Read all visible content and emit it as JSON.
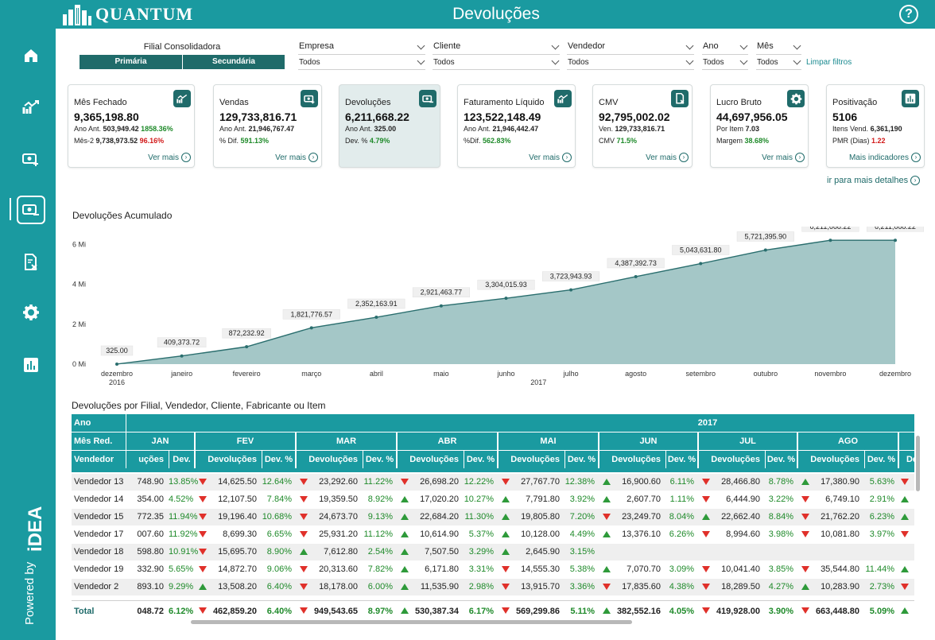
{
  "header": {
    "brand": "QUANTUM",
    "title": "Devoluções",
    "help_label": "?"
  },
  "sidebar": {
    "items": [
      {
        "name": "home-icon"
      },
      {
        "name": "trend-icon"
      },
      {
        "name": "money-plus-icon"
      },
      {
        "name": "money-minus-icon",
        "active": true
      },
      {
        "name": "document-x-icon"
      },
      {
        "name": "gear-icon"
      },
      {
        "name": "bar-chart-icon"
      }
    ],
    "powered_by": "Powered by",
    "powered_brand": "iDEA"
  },
  "filters": {
    "filial_label": "Filial Consolidadora",
    "filial_options": [
      "Primária",
      "Secundária"
    ],
    "empresa": {
      "label": "Empresa",
      "value": "Todos"
    },
    "cliente": {
      "label": "Cliente",
      "value": "Todos"
    },
    "vendedor": {
      "label": "Vendedor",
      "value": "Todos"
    },
    "ano": {
      "label": "Ano",
      "value": "Todos"
    },
    "mes": {
      "label": "Mês",
      "value": "Todos"
    },
    "clear_label": "Limpar filtros"
  },
  "cards": [
    {
      "title": "Mês Fechado",
      "value": "9,365,198.80",
      "l1_label": "Ano Ant.",
      "l1_value": "503,949.42",
      "l1_extra": "1858.36%",
      "l1_extra_color": "green",
      "l2_label": "Mês-2",
      "l2_value": "9,738,973.52",
      "l2_extra": "96.16%",
      "l2_extra_color": "red",
      "link": "Ver mais",
      "icon": "trend-icon"
    },
    {
      "title": "Vendas",
      "value": "129,733,816.71",
      "l1_label": "Ano Ant.",
      "l1_value": "21,946,767.47",
      "l1_extra": "",
      "l2_label": "% Dif.",
      "l2_value": "",
      "l2_extra": "591.13%",
      "l2_extra_color": "green",
      "link": "Ver mais",
      "icon": "money-plus-icon"
    },
    {
      "title": "Devoluções",
      "value": "6,211,668.22",
      "l1_label": "Ano Ant.",
      "l1_value": "325.00",
      "l1_extra": "",
      "l2_label": "Dev. %",
      "l2_value": "",
      "l2_extra": "4.79%",
      "l2_extra_color": "green",
      "link": "",
      "icon": "money-minus-icon"
    },
    {
      "title": "Faturamento Líquido",
      "value": "123,522,148.49",
      "l1_label": "Ano Ant.",
      "l1_value": "21,946,442.47",
      "l1_extra": "",
      "l2_label": "%Dif.",
      "l2_value": "",
      "l2_extra": "562.83%",
      "l2_extra_color": "green",
      "link": "Ver mais",
      "icon": "trend-icon"
    },
    {
      "title": "CMV",
      "value": "92,795,002.02",
      "l1_label": "Ven.",
      "l1_value": "129,733,816.71",
      "l1_extra": "",
      "l2_label": "CMV",
      "l2_value": "",
      "l2_extra": "71.5%",
      "l2_extra_color": "green",
      "link": "Ver mais",
      "icon": "document-x-icon"
    },
    {
      "title": "Lucro Bruto",
      "value": "44,697,956.05",
      "l1_label": "Por Item",
      "l1_value": "7.03",
      "l1_extra": "",
      "l2_label": "Margem",
      "l2_value": "",
      "l2_extra": "38.68%",
      "l2_extra_color": "green",
      "link": "Ver mais",
      "icon": "gear-icon"
    },
    {
      "title": "Positivação",
      "value": "5106",
      "l1_label": "Itens Vend.",
      "l1_value": "6,361,190",
      "l1_extra": "",
      "l2_label": "PMR (Dias)",
      "l2_value": "",
      "l2_extra": "1.22",
      "l2_extra_color": "red",
      "link": "Mais indicadores",
      "icon": "bar-chart-icon"
    }
  ],
  "more_details": "ir para mais detalhes",
  "chart_title": "Devoluções Acumulado",
  "chart_data": {
    "type": "area",
    "title": "Devoluções Acumulado",
    "categories": [
      "dezembro",
      "janeiro",
      "fevereiro",
      "março",
      "abril",
      "maio",
      "junho",
      "julho",
      "agosto",
      "setembro",
      "outubro",
      "novembro",
      "dezembro"
    ],
    "year_labels": [
      {
        "label": "2016",
        "index": 0
      },
      {
        "label": "2017",
        "index": 6.5
      }
    ],
    "values": [
      325.0,
      409373.72,
      872232.92,
      1821776.57,
      2352163.91,
      2921463.77,
      3304015.93,
      3723943.93,
      4387392.73,
      5043631.8,
      5721395.9,
      6211668.22,
      6211668.22
    ],
    "data_labels": [
      "325.00",
      "409,373.72",
      "872,232.92",
      "1,821,776.57",
      "2,352,163.91",
      "2,921,463.77",
      "3,304,015.93",
      "3,723,943.93",
      "4,387,392.73",
      "5,043,631.80",
      "5,721,395.90",
      "6,211,668.22",
      "6,211,668.22"
    ],
    "y_ticks": [
      "0 Mi",
      "2 Mi",
      "4 Mi",
      "6 Mi"
    ],
    "y_tick_values": [
      0,
      2000000,
      4000000,
      6000000
    ],
    "ylim": [
      0,
      6500000
    ],
    "fill_color": "#9fc4c4",
    "line_color": "#2a6e6e"
  },
  "table": {
    "title": "Devoluções por Filial, Vendedor, Cliente, Fabricante ou Item",
    "row_header_labels": [
      "Ano",
      "Mês Red.",
      "Vendedor"
    ],
    "year": "2017",
    "months": [
      "JAN",
      "FEV",
      "MAR",
      "ABR",
      "MAI",
      "JUN",
      "JUL",
      "AGO"
    ],
    "col_dev": "Devoluções",
    "col_pct": "Dev. %",
    "first_col_dev": "uções",
    "rows": [
      {
        "name": "Vendedor 13",
        "cells": [
          [
            "",
            "748.90",
            "13.85%"
          ],
          [
            "down",
            "14,625.50",
            "12.64%"
          ],
          [
            "down",
            "23,292.60",
            "11.22%"
          ],
          [
            "down",
            "26,698.20",
            "12.22%"
          ],
          [
            "down",
            "27,767.70",
            "12.38%"
          ],
          [
            "up",
            "16,900.60",
            "6.11%"
          ],
          [
            "down",
            "28,466.80",
            "8.78%"
          ],
          [
            "up",
            "17,380.90",
            "5.63%"
          ]
        ]
      },
      {
        "name": "Vendedor 14",
        "cells": [
          [
            "",
            "354.00",
            "4.52%"
          ],
          [
            "down",
            "12,107.50",
            "7.84%"
          ],
          [
            "down",
            "19,359.50",
            "8.92%"
          ],
          [
            "up",
            "17,020.20",
            "10.27%"
          ],
          [
            "up",
            "7,791.80",
            "3.92%"
          ],
          [
            "up",
            "2,607.70",
            "1.11%"
          ],
          [
            "down",
            "6,444.90",
            "3.22%"
          ],
          [
            "down",
            "6,749.10",
            "2.91%"
          ]
        ]
      },
      {
        "name": "Vendedor 15",
        "cells": [
          [
            "",
            "772.35",
            "11.94%"
          ],
          [
            "down",
            "19,196.40",
            "10.68%"
          ],
          [
            "down",
            "24,673.70",
            "9.13%"
          ],
          [
            "up",
            "22,684.20",
            "11.30%"
          ],
          [
            "up",
            "19,805.80",
            "7.20%"
          ],
          [
            "down",
            "23,249.70",
            "8.04%"
          ],
          [
            "up",
            "22,662.40",
            "8.84%"
          ],
          [
            "down",
            "21,762.20",
            "6.23%"
          ]
        ]
      },
      {
        "name": "Vendedor 17",
        "cells": [
          [
            "",
            "007.60",
            "11.92%"
          ],
          [
            "down",
            "8,699.30",
            "6.65%"
          ],
          [
            "down",
            "25,931.20",
            "11.12%"
          ],
          [
            "up",
            "10,614.90",
            "5.37%"
          ],
          [
            "up",
            "10,128.00",
            "4.49%"
          ],
          [
            "up",
            "13,376.10",
            "6.26%"
          ],
          [
            "down",
            "8,994.60",
            "3.98%"
          ],
          [
            "down",
            "10,081.80",
            "3.97%"
          ]
        ]
      },
      {
        "name": "Vendedor 18",
        "cells": [
          [
            "",
            "598.80",
            "10.91%"
          ],
          [
            "down",
            "15,695.70",
            "8.90%"
          ],
          [
            "up",
            "7,612.80",
            "2.54%"
          ],
          [
            "up",
            "7,507.50",
            "3.29%"
          ],
          [
            "up",
            "2,645.90",
            "3.15%"
          ],
          [
            "",
            "",
            ""
          ],
          [
            "",
            "",
            ""
          ],
          [
            "",
            "",
            ""
          ]
        ]
      },
      {
        "name": "Vendedor 19",
        "cells": [
          [
            "",
            "332.90",
            "5.65%"
          ],
          [
            "down",
            "14,872.70",
            "9.06%"
          ],
          [
            "down",
            "20,313.60",
            "7.82%"
          ],
          [
            "up",
            "6,171.80",
            "3.31%"
          ],
          [
            "down",
            "14,555.30",
            "5.38%"
          ],
          [
            "up",
            "7,070.70",
            "3.09%"
          ],
          [
            "down",
            "10,041.40",
            "3.85%"
          ],
          [
            "down",
            "35,544.80",
            "11.44%"
          ]
        ]
      },
      {
        "name": "Vendedor 2",
        "cells": [
          [
            "",
            "893.10",
            "9.29%"
          ],
          [
            "up",
            "13,508.20",
            "6.40%"
          ],
          [
            "down",
            "18,178.00",
            "6.00%"
          ],
          [
            "up",
            "11,535.90",
            "2.98%"
          ],
          [
            "down",
            "13,915.70",
            "3.36%"
          ],
          [
            "down",
            "17,835.60",
            "4.38%"
          ],
          [
            "down",
            "18,289.50",
            "4.27%"
          ],
          [
            "up",
            "10,283.90",
            "2.73%"
          ]
        ]
      }
    ],
    "total": {
      "name": "Total",
      "cells": [
        [
          "",
          "048.72",
          "6.12%"
        ],
        [
          "down",
          "462,859.20",
          "6.40%"
        ],
        [
          "down",
          "949,543.65",
          "8.97%"
        ],
        [
          "up",
          "530,387.34",
          "6.17%"
        ],
        [
          "down",
          "569,299.86",
          "5.11%"
        ],
        [
          "up",
          "382,552.16",
          "4.05%"
        ],
        [
          "down",
          "419,928.00",
          "3.90%"
        ],
        [
          "down",
          "663,448.80",
          "5.09%"
        ]
      ]
    },
    "colors": {
      "up": "#2e9a3a",
      "down": "#e0302a",
      "pct": "#1f8a2a",
      "header": "#1a9aa0"
    }
  }
}
